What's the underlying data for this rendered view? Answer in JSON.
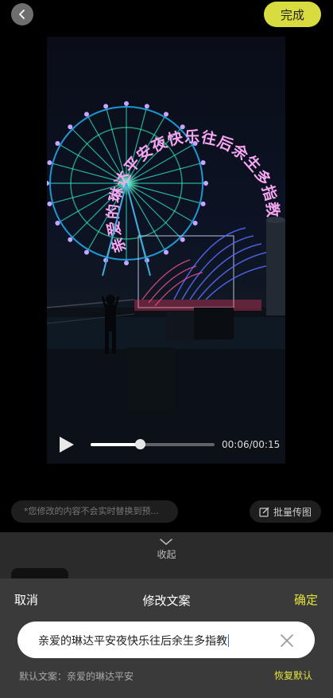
{
  "header": {
    "back_icon": "chevron-left-icon",
    "done_label": "完成",
    "accent_color": "#d8dc3f"
  },
  "video": {
    "overlay_text_circle": "亲爱的琳达平安夜快乐往后余生多指教",
    "current_time": "00:06",
    "duration": "00:15",
    "time_display": "00:06/00:15",
    "progress_fraction": 0.4
  },
  "hint": {
    "text": "*您修改的内容不会实时替换到预..."
  },
  "batch": {
    "label": "批量传图",
    "icon": "edit-icon"
  },
  "collapse": {
    "label": "收起"
  },
  "sheet": {
    "cancel_label": "取消",
    "title": "修改文案",
    "confirm_label": "确定",
    "input_value": "亲爱的琳达平安夜快乐往后余生多指教",
    "default_text": "默认文案：亲爱的琳达平安",
    "restore_label": "恢复默认",
    "confirm_color": "#e3e33c"
  }
}
